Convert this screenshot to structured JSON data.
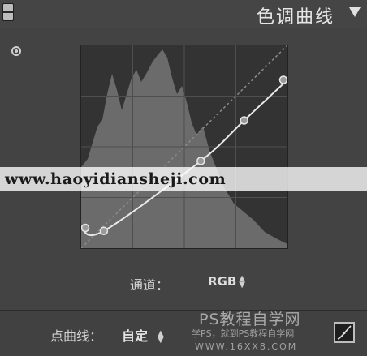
{
  "header": {
    "title": "色调曲线"
  },
  "icons": {
    "panel_switch": "panel-switch-icon",
    "collapse": "triangle-down-icon",
    "target": "target-adjust-icon",
    "curve_mode": "point-curve-edit-icon"
  },
  "watermark": {
    "url": "www.haoyidiansheji.com",
    "logo": "PS教程自学网",
    "sub": "学PS，就到PS教程自学网",
    "site": "WWW.16XX8.COM"
  },
  "channel": {
    "label": "通道：",
    "value": "RGB"
  },
  "point_curve": {
    "label": "点曲线：",
    "value": "自定"
  },
  "colors": {
    "panel_bg": "#434343",
    "graph_bg": "#333333",
    "histogram": "#6a6a6a",
    "curve": "#e6e6e6"
  },
  "curve_points": [
    {
      "in": 0,
      "out": 0.1
    },
    {
      "in": 0.11,
      "out": 0.085
    },
    {
      "in": 0.58,
      "out": 0.43
    },
    {
      "in": 0.79,
      "out": 0.63
    },
    {
      "in": 1.0,
      "out": 0.83
    }
  ]
}
